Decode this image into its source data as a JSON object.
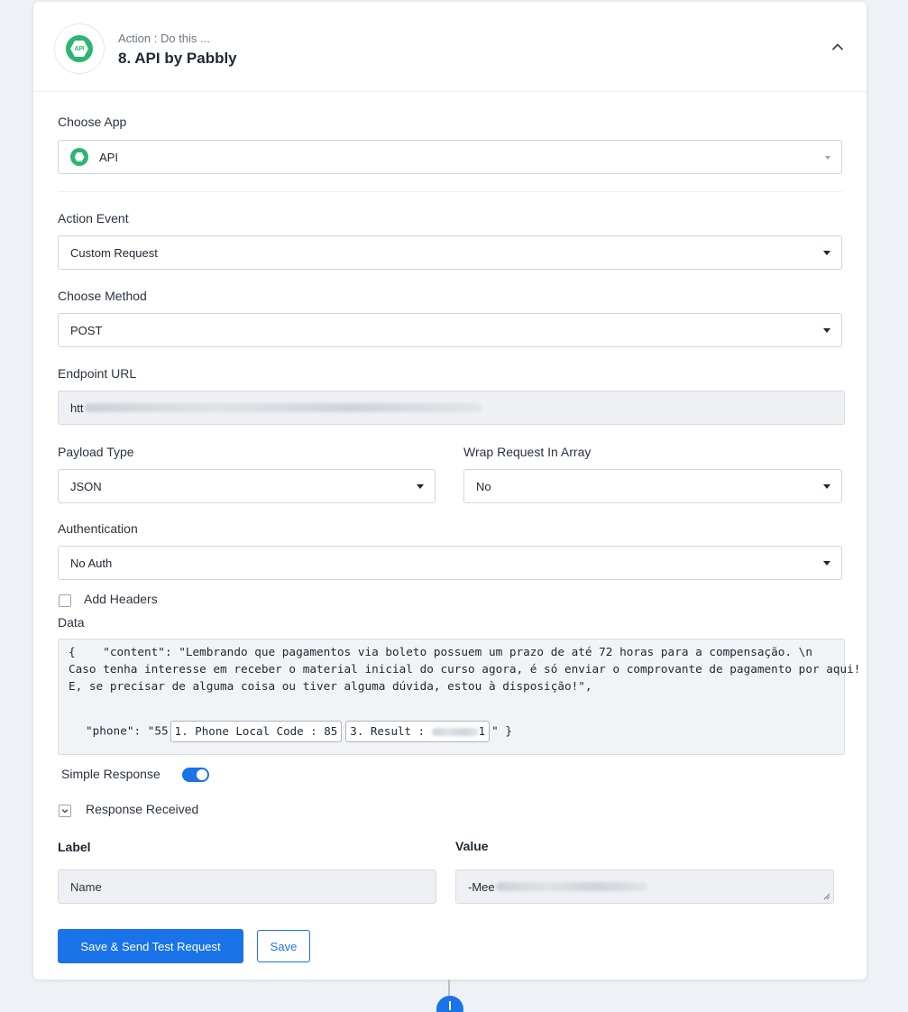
{
  "header": {
    "subtitle": "Action : Do this ...",
    "title": "8. API by Pabbly",
    "badge_text": "API"
  },
  "choose_app": {
    "label": "Choose App",
    "value": "API"
  },
  "action_event": {
    "label": "Action Event",
    "value": "Custom Request"
  },
  "choose_method": {
    "label": "Choose Method",
    "value": "POST"
  },
  "endpoint_url": {
    "label": "Endpoint URL",
    "value": "htt"
  },
  "payload_type": {
    "label": "Payload Type",
    "value": "JSON"
  },
  "wrap_request": {
    "label": "Wrap Request In Array",
    "value": "No"
  },
  "authentication": {
    "label": "Authentication",
    "value": "No Auth"
  },
  "add_headers": {
    "label": "Add Headers",
    "checked": false
  },
  "data": {
    "label": "Data",
    "line1": "{    \"content\": \"Lembrando que pagamentos via boleto possuem um prazo de até 72 horas para a compensação. \\n",
    "line2": "Caso tenha interesse em receber o material inicial do curso agora, é só enviar o comprovante de pagamento por aqui!",
    "line3": "E, se precisar de alguma coisa ou tiver alguma dúvida, estou à disposição!\",",
    "phone_prefix": "\"phone\": \"55",
    "pill1": "1. Phone Local Code : 85",
    "pill2": "3. Result :",
    "pill2_tail": "1",
    "phone_suffix": "\" }"
  },
  "simple_response": {
    "label": "Simple Response",
    "enabled": true
  },
  "response_received": {
    "label": "Response Received"
  },
  "response_table": {
    "label_header": "Label",
    "value_header": "Value",
    "row_label": "Name",
    "row_value_prefix": "-Mee"
  },
  "buttons": {
    "save_send": "Save & Send Test Request",
    "save": "Save"
  },
  "colors": {
    "accent": "#1a73e8",
    "api_green": "#2bb673"
  }
}
